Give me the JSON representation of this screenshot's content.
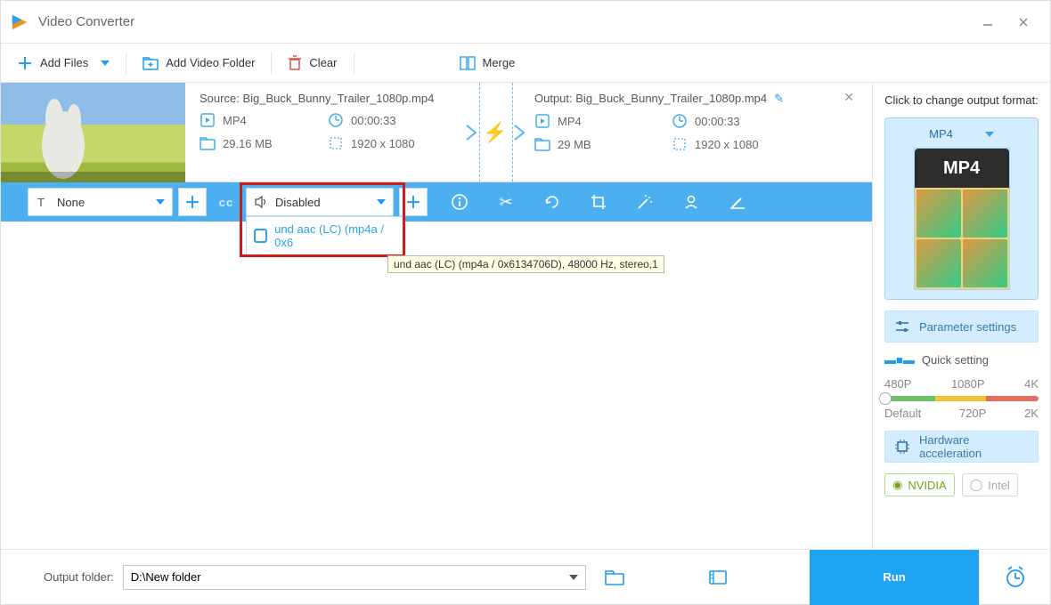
{
  "titlebar": {
    "title": "Video Converter"
  },
  "toolbar": {
    "add_files": "Add Files",
    "add_folder": "Add Video Folder",
    "clear": "Clear",
    "merge": "Merge"
  },
  "job": {
    "source_prefix": "Source:",
    "source": "Big_Buck_Bunny_Trailer_1080p.mp4",
    "src_format": "MP4",
    "src_time": "00:00:33",
    "src_size": "29.16 MB",
    "src_res": "1920 x 1080",
    "output_prefix": "Output:",
    "output": "Big_Buck_Bunny_Trailer_1080p.mp4",
    "out_format": "MP4",
    "out_time": "00:00:33",
    "out_size": "29 MB",
    "out_res": "1920 x 1080"
  },
  "toolstrip": {
    "subtitle": "None",
    "audio": "Disabled",
    "audio_option": "und aac (LC) (mp4a / 0x6",
    "tooltip": "und aac (LC) (mp4a / 0x6134706D), 48000 Hz, stereo,1"
  },
  "side": {
    "title": "Click to change output format:",
    "format": "MP4",
    "format_badge": "MP4",
    "param_btn": "Parameter settings",
    "quick_label": "Quick setting",
    "preset_top": {
      "a": "480P",
      "b": "1080P",
      "c": "4K"
    },
    "preset_bot": {
      "a": "Default",
      "b": "720P",
      "c": "2K"
    },
    "hw_btn": "Hardware acceleration",
    "chip_nvidia": "NVIDIA",
    "chip_intel": "Intel"
  },
  "bottom": {
    "label": "Output folder:",
    "path": "D:\\New folder",
    "run": "Run"
  }
}
